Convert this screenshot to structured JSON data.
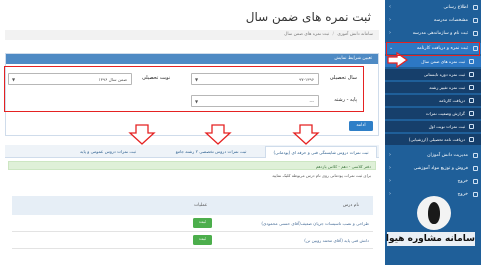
{
  "sidebar": {
    "items": [
      {
        "label": "اطلاع رسانی",
        "chev": "›"
      },
      {
        "label": "مشخصات مدرسه",
        "chev": "‹"
      },
      {
        "label": "ثبت نام و سازماندهی مدرسه",
        "chev": "‹"
      },
      {
        "label": "ثبت نمره و دریافت کارنامه",
        "chev": "⌄"
      }
    ],
    "subitems": [
      "ثبت نمره های ضمن سال",
      "ثبت نمره دوره تابستانی",
      "ثبت نمره تغییر رشته",
      "دریافت کارنامه",
      "گزارش وضعیت نمرات",
      "ثبت نمرات نوبت اول",
      "دریافت نامه تحصیلی (ارزشیابی)"
    ],
    "items_lower": [
      {
        "label": "مدیریت دانش آموزان",
        "chev": "‹"
      },
      {
        "label": "فروش و توزیع مواد آموزشی",
        "chev": "‹"
      },
      {
        "label": "خروج",
        "chev": "‹"
      },
      {
        "label": "خروج",
        "chev": "‹"
      }
    ]
  },
  "logo": {
    "text": "سامانه مشاوره هیوا"
  },
  "page": {
    "title": "ثبت نمره های ضمن سال",
    "breadcrumb": [
      "سامانه دانش آموزی",
      "ثبت نمره های ضمن سال"
    ]
  },
  "filter_panel": {
    "header": "تعیین شرایط نمایش",
    "school_year_label": "سال تحصیلی",
    "school_year_value": "۹۷-۱۳۹۶",
    "term_label": "نوبت تحصیلی",
    "term_value": "ضمن سال ۱۳۹۶",
    "grade_label": "پایه - رشته",
    "grade_value": "---",
    "submit_label": "ادامه"
  },
  "tabs": [
    "ثبت نمرات دروس شایستگی فنی و حرفه ای (پودمانی)",
    "ثبت نمرات دروس تخصصی ۲ رشته جامع",
    "ثبت نمرات دروس عمومی و پایه"
  ],
  "results": {
    "subheader": "دفتر کلاسی - دهم - کلاس یازدهم",
    "hint": "برای ثبت نمرات پودمانی روی نام درس مربوطه کلیک نمایید",
    "col_course": "نام درس",
    "col_actions": "عملیات",
    "rows": [
      {
        "course": "طراحی و نصب تاسیسات جریان ضعیف(آقای حسنی محمودی)",
        "action": "ثبت"
      },
      {
        "course": "دانش فنی پایه (آقای محمد رویین تن)",
        "action": "ثبت"
      }
    ]
  },
  "colors": {
    "sidebar_bg": "#1f5f99",
    "sidebar_sub_bg": "#163f6b",
    "panel_header": "#4e8ac4",
    "primary_button": "#2f7fc7",
    "success_button": "#4cae4c",
    "annotation_red": "#e52222"
  }
}
